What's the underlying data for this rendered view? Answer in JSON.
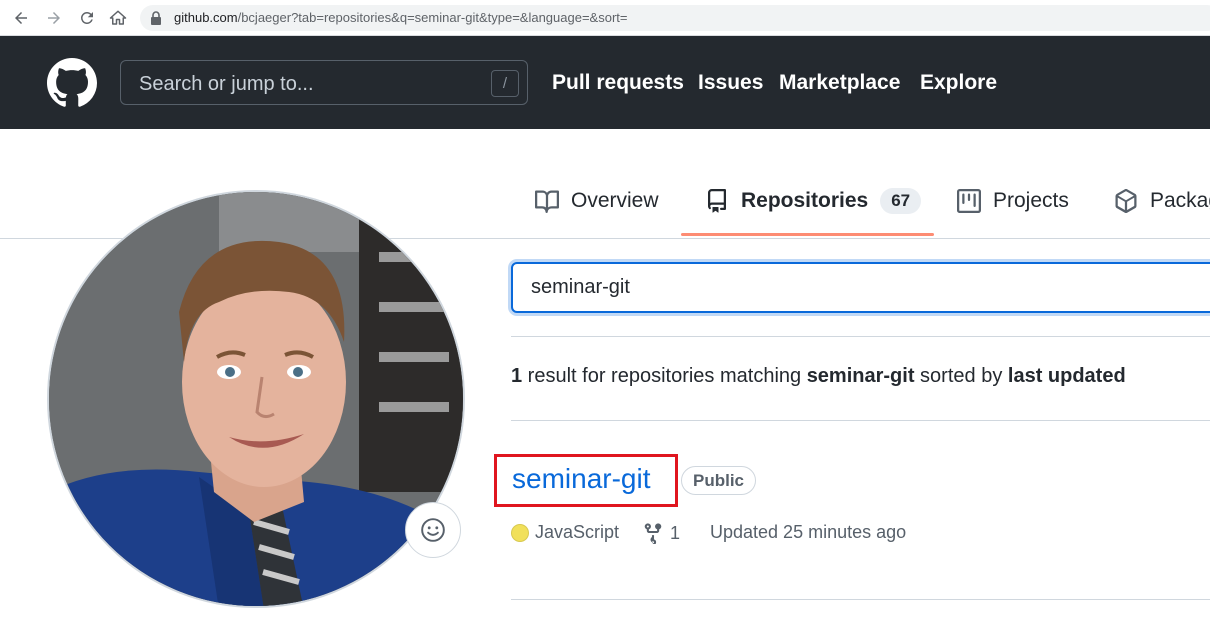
{
  "browser": {
    "url_host": "github.com",
    "url_path": "/bcjaeger?tab=repositories&q=seminar-git&type=&language=&sort="
  },
  "header": {
    "search_placeholder": "Search or jump to...",
    "search_shortcut": "/",
    "nav": [
      "Pull requests",
      "Issues",
      "Marketplace",
      "Explore"
    ]
  },
  "tabs": {
    "overview": "Overview",
    "repositories": "Repositories",
    "repositories_count": "67",
    "projects": "Projects",
    "packages": "Packages"
  },
  "repo_search": {
    "value": "seminar-git"
  },
  "summary": {
    "count": "1",
    "text_a": " result for repositories matching ",
    "query": "seminar-git",
    "text_b": " sorted by ",
    "sort": "last updated"
  },
  "repo": {
    "name": "seminar-git",
    "visibility": "Public",
    "language": "JavaScript",
    "language_color": "#f1e05a",
    "forks": "1",
    "updated": "Updated 25 minutes ago"
  },
  "colors": {
    "header_bg": "#24292f",
    "link": "#0969da",
    "tab_underline": "#fd8c73",
    "highlight_box": "#e0151f"
  },
  "icons": {
    "back": "arrow-left-icon",
    "forward": "arrow-right-icon",
    "reload": "reload-icon",
    "home": "home-icon",
    "lock": "lock-icon",
    "logo": "github-logo-icon",
    "overview": "book-icon",
    "repositories": "repo-icon",
    "projects": "project-icon",
    "packages": "package-icon",
    "emoji": "smiley-icon",
    "forks": "fork-icon"
  }
}
